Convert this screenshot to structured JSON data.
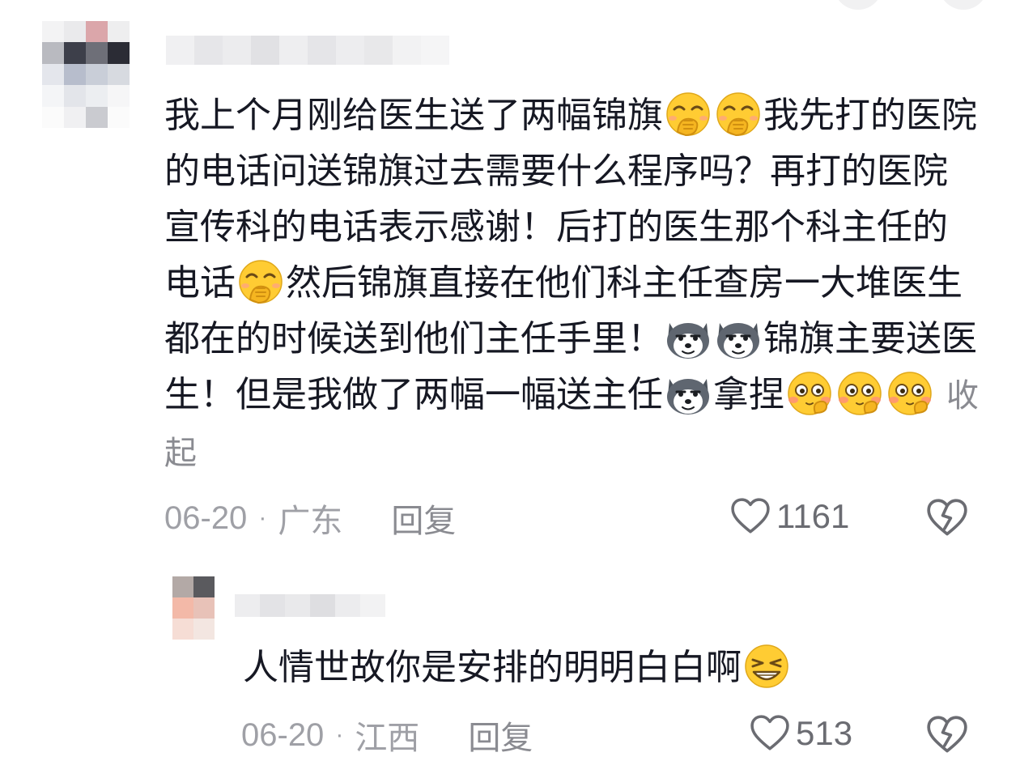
{
  "comments": [
    {
      "text_segments": [
        "我上个月刚给医生送了两幅锦旗",
        "我先打的医院的电话问送锦旗过去需要什么程序吗？再打的医院宣传科的电话表示感谢！后打的医生那个科主任的电话",
        "然后锦旗直接在他们科主任查房一大堆医生都在的时候送到他们主任手里！",
        "锦旗主要送医生！但是我做了两幅一幅送主任",
        "拿捏"
      ],
      "collapse_label": "收起",
      "date": "06-20",
      "location": "广东",
      "reply_label": "回复",
      "likes": "1161",
      "emojis": [
        "cover-mouth-emoji",
        "husky-dog-emoji",
        "pinch-fingers-emoji"
      ]
    },
    {
      "text": "人情世故你是安排的明明白白啊",
      "date": "06-20",
      "location": "江西",
      "reply_label": "回复",
      "likes": "513",
      "emojis": [
        "smirk-emoji"
      ]
    }
  ],
  "separator": "·",
  "colors": {
    "text": "#161823",
    "meta": "#9fa0a6",
    "reply": "#8a8b91",
    "emoji_yellow": "#ffcc33",
    "husky_gray": "#5f6670"
  }
}
